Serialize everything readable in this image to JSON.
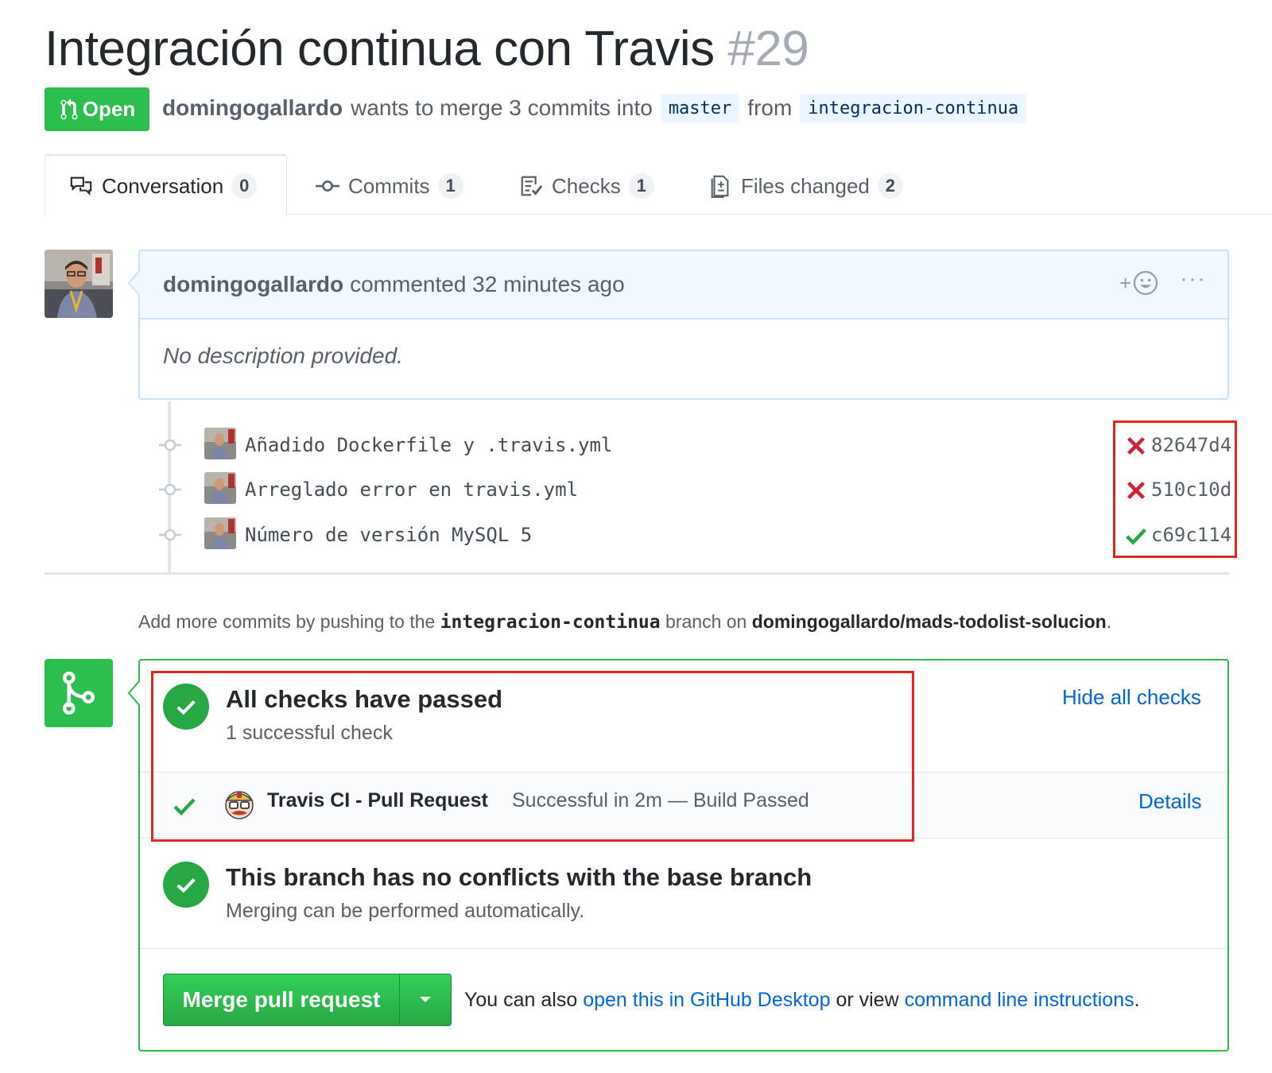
{
  "pr": {
    "title": "Integración continua con Travis",
    "number": "#29",
    "state": "Open",
    "author": "domingogallardo",
    "merge_text": "wants to merge 3 commits into",
    "base_branch": "master",
    "from_text": "from",
    "head_branch": "integracion-continua"
  },
  "tabs": [
    {
      "label": "Conversation",
      "count": "0",
      "icon": "comment-discussion-icon"
    },
    {
      "label": "Commits",
      "count": "1",
      "icon": "git-commit-icon"
    },
    {
      "label": "Checks",
      "count": "1",
      "icon": "checklist-icon"
    },
    {
      "label": "Files changed",
      "count": "2",
      "icon": "file-diff-icon"
    }
  ],
  "comment": {
    "author": "domingogallardo",
    "action": "commented 32 minutes ago",
    "body": "No description provided.",
    "reaction_plus": "+",
    "more": "···"
  },
  "commits": [
    {
      "message": "Añadido Dockerfile y .travis.yml",
      "sha": "82647d4",
      "status": "failure"
    },
    {
      "message": "Arreglado error en travis.yml",
      "sha": "510c10d",
      "status": "failure"
    },
    {
      "message": "Número de versión MySQL 5",
      "sha": "c69c114",
      "status": "success"
    }
  ],
  "add_more": {
    "prefix": "Add more commits by pushing to the",
    "branch": "integracion-continua",
    "middle": "branch on",
    "repo": "domingogallardo/mads-todolist-solucion",
    "suffix": "."
  },
  "checks": {
    "title": "All checks have passed",
    "subtitle": "1 successful check",
    "hide_link": "Hide all checks",
    "items": [
      {
        "name": "Travis CI - Pull Request",
        "description": "Successful in 2m — Build Passed",
        "details_link": "Details"
      }
    ]
  },
  "conflicts": {
    "title": "This branch has no conflicts with the base branch",
    "subtitle": "Merging can be performed automatically."
  },
  "merge": {
    "button_label": "Merge pull request",
    "alt_prefix": "You can also",
    "desktop_link": "open this in GitHub Desktop",
    "alt_middle": "or view",
    "cli_link": "command line instructions",
    "alt_suffix": "."
  },
  "colors": {
    "open_green": "#2cbe4e",
    "success_green": "#28a745",
    "failure_red": "#cb2431",
    "link_blue": "#0366d6",
    "annotation_red": "#e3261f"
  }
}
